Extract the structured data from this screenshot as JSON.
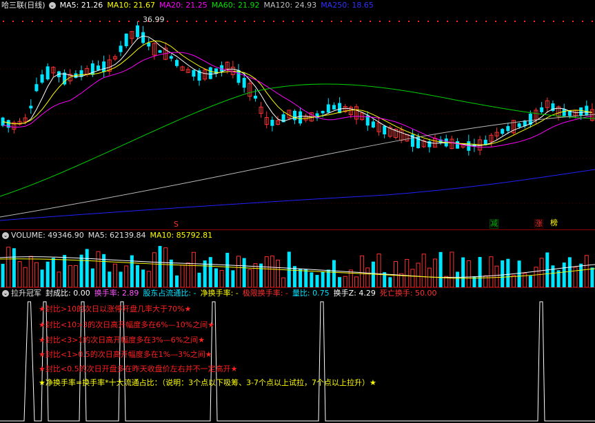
{
  "main": {
    "title": "哈三联(日线)",
    "ma": [
      {
        "label": "MA5: 21.26",
        "color": "#ffffff"
      },
      {
        "label": "MA10: 21.67",
        "color": "#ffff00"
      },
      {
        "label": "MA20: 21.25",
        "color": "#ff00ff"
      },
      {
        "label": "MA60: 21.92",
        "color": "#00e000"
      },
      {
        "label": "MA120: 24.93",
        "color": "#c0c0c0"
      },
      {
        "label": "MA250: 18.65",
        "color": "#3030ff"
      }
    ],
    "high_label": "36.99",
    "markers": [
      {
        "text": "S",
        "color": "#ff3030"
      },
      {
        "text": "减",
        "color": "#00c000"
      },
      {
        "text": "涨",
        "color": "#ff3030"
      },
      {
        "text": "榜",
        "color": "#ffff00"
      }
    ]
  },
  "volume": {
    "title": "VOLUME: 49346.90",
    "ma5": "MA5: 62139.84",
    "ma10": "MA10: 85792.81"
  },
  "indicator": {
    "title": "拉升冠军",
    "fields": [
      {
        "label": "封成比: 0.00",
        "color": "#ffffff"
      },
      {
        "label": "换手率: 2.89",
        "color": "#ff55ff"
      },
      {
        "label": "股东占流通比: -",
        "color": "#00e5ff"
      },
      {
        "label": "净换手率: -",
        "color": "#ffff00"
      },
      {
        "label": "极限换手率: -",
        "color": "#ff3030"
      },
      {
        "label": "量比: 0.75",
        "color": "#00e5ff"
      },
      {
        "label": "换手Z: 4.29",
        "color": "#ffffff"
      },
      {
        "label": "死亡换手: 50.00",
        "color": "#ff3030"
      }
    ],
    "notes": [
      {
        "text": "★封比>10的次日以涨停开盘几率大于70%★",
        "color": "#ff2020"
      },
      {
        "text": "★封比<10>3的次日高开幅度多在6%—10%之间★",
        "color": "#ff2020"
      },
      {
        "text": "★封比<3>1的次日高开幅度多在3%—6%之间★",
        "color": "#ff2020"
      },
      {
        "text": "★封比<1>0.5的次日高开幅度多在1%—3%之间★",
        "color": "#ff2020"
      },
      {
        "text": "★封比<0.5的次日开盘多在昨天收盘价左右并不一定高开★",
        "color": "#ff2020"
      },
      {
        "text": "★净换手率=换手率*十大流通占比：（说明：3个点以下吸筹、3-7个点以上试拉，7个点以上拉升）★",
        "color": "#ffff00"
      }
    ]
  }
}
